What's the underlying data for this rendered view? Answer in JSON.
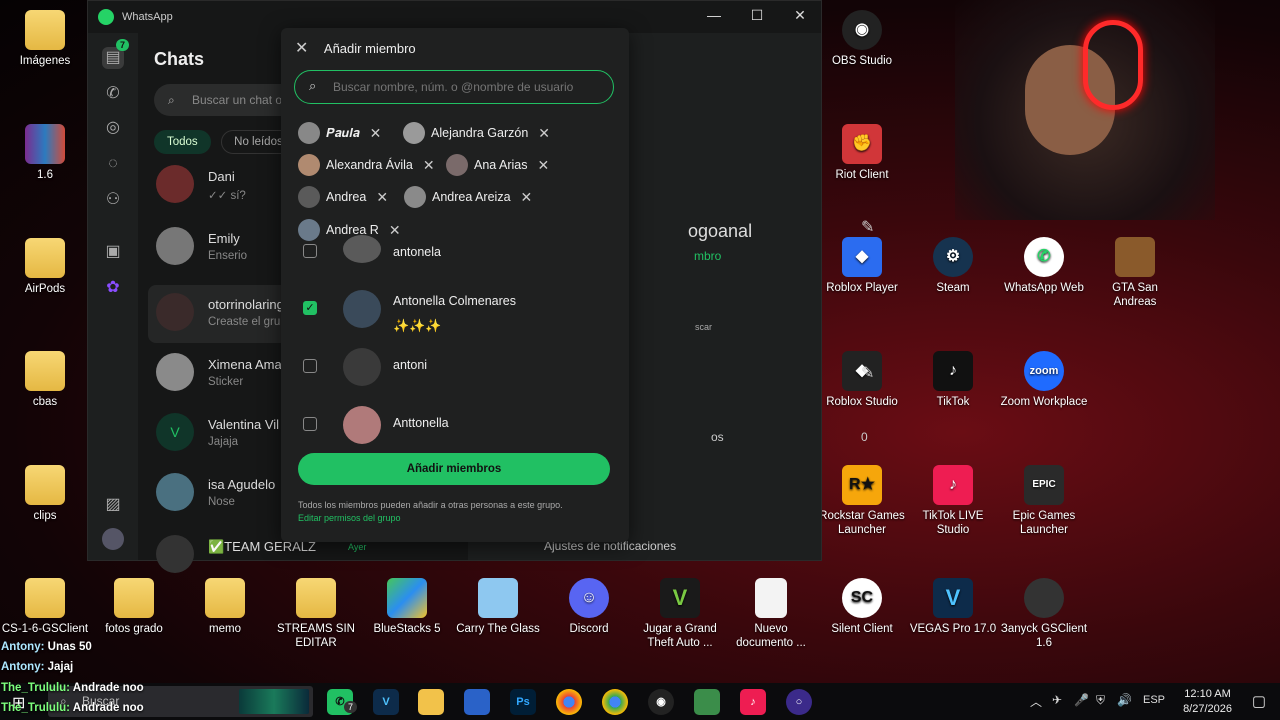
{
  "desktop_left": [
    {
      "label": "Imágenes",
      "icon": "pictures-folder-icon"
    },
    {
      "label": "1.6",
      "icon": "winrar-icon"
    },
    {
      "label": "AirPods",
      "icon": "folder-icon"
    },
    {
      "label": "cbas",
      "icon": "folder-icon"
    },
    {
      "label": "clips",
      "icon": "folder-icon"
    }
  ],
  "desktop_right": [
    {
      "label": "OBS Studio",
      "icon": "obs-icon",
      "bg": "#222"
    },
    {
      "label": "Riot Client",
      "icon": "riot-icon",
      "bg": "#d13639"
    },
    {
      "label": "Roblox Player",
      "icon": "roblox-icon",
      "bg": "#2b6cf0"
    },
    {
      "label": "Steam",
      "icon": "steam-icon",
      "bg": "#16334f"
    },
    {
      "label": "WhatsApp Web",
      "icon": "whatsapp-icon",
      "bg": "#fff"
    },
    {
      "label": "GTA San Andreas",
      "icon": "gta-sa-icon",
      "bg": "#8a5a2b"
    },
    {
      "label": "Roblox Studio",
      "icon": "roblox-studio-icon",
      "bg": "#222"
    },
    {
      "label": "TikTok",
      "icon": "tiktok-icon",
      "bg": "#111"
    },
    {
      "label": "Zoom Workplace",
      "icon": "zoom-icon",
      "bg": "#1f6bff"
    },
    {
      "label": "Rockstar Games Launcher",
      "icon": "rockstar-icon",
      "bg": "#f6a60b"
    },
    {
      "label": "TikTok LIVE Studio",
      "icon": "tiktok-live-icon",
      "bg": "#ee1d52"
    },
    {
      "label": "Epic Games Launcher",
      "icon": "epic-games-icon",
      "bg": "#2a2a2a"
    }
  ],
  "desktop_bottom": [
    {
      "label": "CS-1-6-GSClient",
      "icon": "folder-icon"
    },
    {
      "label": "fotos grado",
      "icon": "folder-icon"
    },
    {
      "label": "memo",
      "icon": "folder-icon"
    },
    {
      "label": "STREAMS SIN EDITAR",
      "icon": "folder-icon"
    },
    {
      "label": "BlueStacks 5",
      "icon": "bluestacks-icon"
    },
    {
      "label": "Carry The Glass",
      "icon": "game-icon"
    },
    {
      "label": "Discord",
      "icon": "discord-icon"
    },
    {
      "label": "Jugar a Grand Theft Auto ...",
      "icon": "gta-v-icon"
    },
    {
      "label": "Nuevo documento ...",
      "icon": "document-icon"
    },
    {
      "label": "Silent Client",
      "icon": "silent-client-icon"
    },
    {
      "label": "VEGAS Pro 17.0",
      "icon": "vegas-icon"
    },
    {
      "label": "Зanyck GSClient 1.6",
      "icon": "cs-icon"
    }
  ],
  "whatsapp": {
    "title": "WhatsApp",
    "chats_title": "Chats",
    "unread_badge": "7",
    "search_placeholder": "Buscar un chat o",
    "filters": [
      "Todos",
      "No leídos o"
    ],
    "chats": [
      {
        "name": "Dani",
        "sub": "✓✓ sí?"
      },
      {
        "name": "Emily",
        "sub": "Enserio"
      },
      {
        "name": "otorrinolaring",
        "sub": "Creaste el grupo"
      },
      {
        "name": "Ximena Ama",
        "sub": "Sticker"
      },
      {
        "name": "Valentina Vil",
        "sub": "Jajaja",
        "initial": "V"
      },
      {
        "name": "isa Agudelo",
        "sub": "Nose"
      },
      {
        "name": "✅TEAM GERALZ",
        "sub": "Ayer"
      }
    ],
    "right_pane": {
      "group_name_fragment": "ogoanal",
      "members_fragment": "mbro",
      "search_fragment": "scar",
      "files_fragment": "os",
      "files_count": "0",
      "notif_label": "Ajustes de notificaciones"
    }
  },
  "dialog": {
    "title": "Añadir miembro",
    "search_placeholder": "Buscar nombre, núm. o @nombre de usuario",
    "selected": [
      "𝑷𝒂𝒖𝒍𝒂",
      "Alejandra Garzón",
      "Alexandra Ávila",
      "Ana Arias",
      "Andrea",
      "Andrea Areiza",
      "Andrea R"
    ],
    "members": [
      {
        "name": "antonela",
        "checked": false
      },
      {
        "name": "Antonella Colmenares",
        "status": "✨✨✨",
        "checked": true
      },
      {
        "name": "antoni",
        "checked": false
      },
      {
        "name": "Anttonella",
        "checked": false
      }
    ],
    "add_button": "Añadir miembros",
    "note": "Todos los miembros pueden añadir a otras personas a este grupo.",
    "note_link": "Editar permisos del grupo"
  },
  "stream_chat": [
    {
      "user": "Antony:",
      "msg": "Unas 50"
    },
    {
      "user": "Antony:",
      "msg": "Jajaj"
    },
    {
      "user": "The_Trululu:",
      "msg": "Andrade noo"
    },
    {
      "user": "The_Trululu:",
      "msg": "Andrade noo"
    }
  ],
  "taskbar": {
    "search_label": "Buscar",
    "whatsapp_badge": "7",
    "lang": "ESP",
    "time": "12:10 AM",
    "date": "8/27/2026"
  }
}
